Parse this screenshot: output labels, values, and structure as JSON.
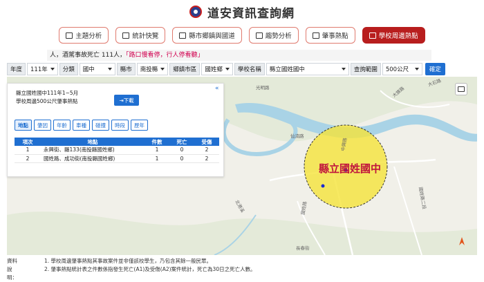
{
  "site": {
    "title": "道安資訊查詢網"
  },
  "nav": {
    "items": [
      {
        "label": "主題分析",
        "active": false
      },
      {
        "label": "統計快覽",
        "active": false
      },
      {
        "label": "縣市鄉鎮與國道",
        "active": false
      },
      {
        "label": "趨勢分析",
        "active": false
      },
      {
        "label": "肇事熱點",
        "active": false
      },
      {
        "label": "學校周邊熱點",
        "active": true
      }
    ]
  },
  "ticker": {
    "text": "人，酒駕事故死亡 111人，",
    "highlight": "「路口慢看停，行人停看聽」"
  },
  "filters": {
    "year_label": "年度",
    "year_value": "111年",
    "category_label": "分類",
    "category_value": "國中",
    "county_label": "縣市",
    "county_value": "南投縣",
    "town_label": "鄉鎮市區",
    "town_value": "國姓鄉",
    "school_label": "學校名稱",
    "school_value": "縣立國姓國中",
    "range_label": "查詢範圍",
    "range_value": "500公尺",
    "confirm_label": "確定"
  },
  "panel": {
    "line1": "縣立國姓國中111年1~5月",
    "line2": "學校周邊500公尺肇事熱點",
    "download_label": "下載",
    "collapse_icon": "«",
    "tabs": [
      "地點",
      "肇因",
      "年齡",
      "車種",
      "碰撞",
      "時段",
      "歷年"
    ],
    "active_tab": 0,
    "table": {
      "headers": [
        "項次",
        "地點",
        "件數",
        "死亡",
        "受傷"
      ],
      "rows": [
        [
          "1",
          "永興街、縣133(南投縣國姓鄉)",
          "1",
          "0",
          "2"
        ],
        [
          "2",
          "國姓路、成功街(南投縣國姓鄉)",
          "1",
          "0",
          "2"
        ]
      ]
    }
  },
  "map": {
    "school_label": "縣立國姓國中",
    "road_labels": [
      "中興路",
      "光明路",
      "仙湳路",
      "國姓路",
      "北港溪",
      "大旗路",
      "大石路",
      "國姓路二段",
      "長春街"
    ],
    "circle_color": "#f5e43a",
    "marker_color": "#1a2bd1",
    "river_color": "#a9d3e6"
  },
  "notes": {
    "label": "資料說明：",
    "line1": "1. 學校周邊肇事熱點其事故案件並非僅該校學生，乃包含其餘一般民眾。",
    "line2": "2. 肇事熱點統計表之件數係指發生死亡(A1)及受傷(A2)案件統計，死亡為30日之死亡人數。"
  }
}
